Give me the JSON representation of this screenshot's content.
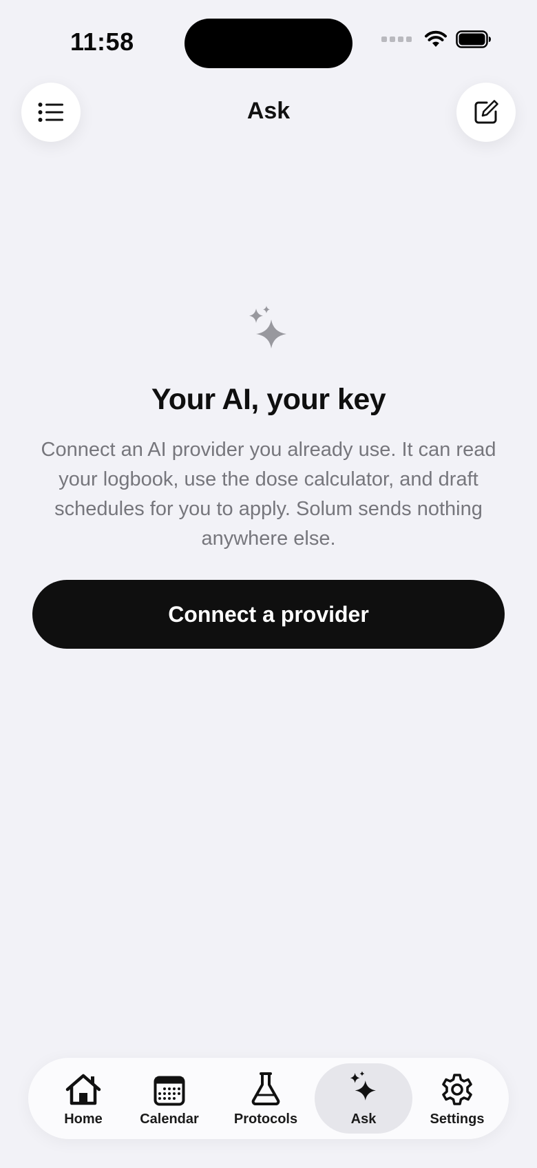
{
  "status_bar": {
    "time": "11:58"
  },
  "header": {
    "title": "Ask"
  },
  "empty_state": {
    "title": "Your AI, your key",
    "body": "Connect an AI provider you already use. It can read your logbook, use the dose calculator, and draft schedules for you to apply. Solum sends nothing anywhere else.",
    "cta_label": "Connect a provider"
  },
  "tab_bar": {
    "items": [
      {
        "label": "Home",
        "icon": "house-icon"
      },
      {
        "label": "Calendar",
        "icon": "calendar-icon"
      },
      {
        "label": "Protocols",
        "icon": "flask-icon"
      },
      {
        "label": "Ask",
        "icon": "sparkles-icon",
        "active": true
      },
      {
        "label": "Settings",
        "icon": "gear-icon"
      }
    ]
  },
  "colors": {
    "background": "#f2f2f7",
    "primary_button": "#0f0f0f",
    "body_text": "#76767c",
    "active_tab": "#e6e6eb"
  }
}
